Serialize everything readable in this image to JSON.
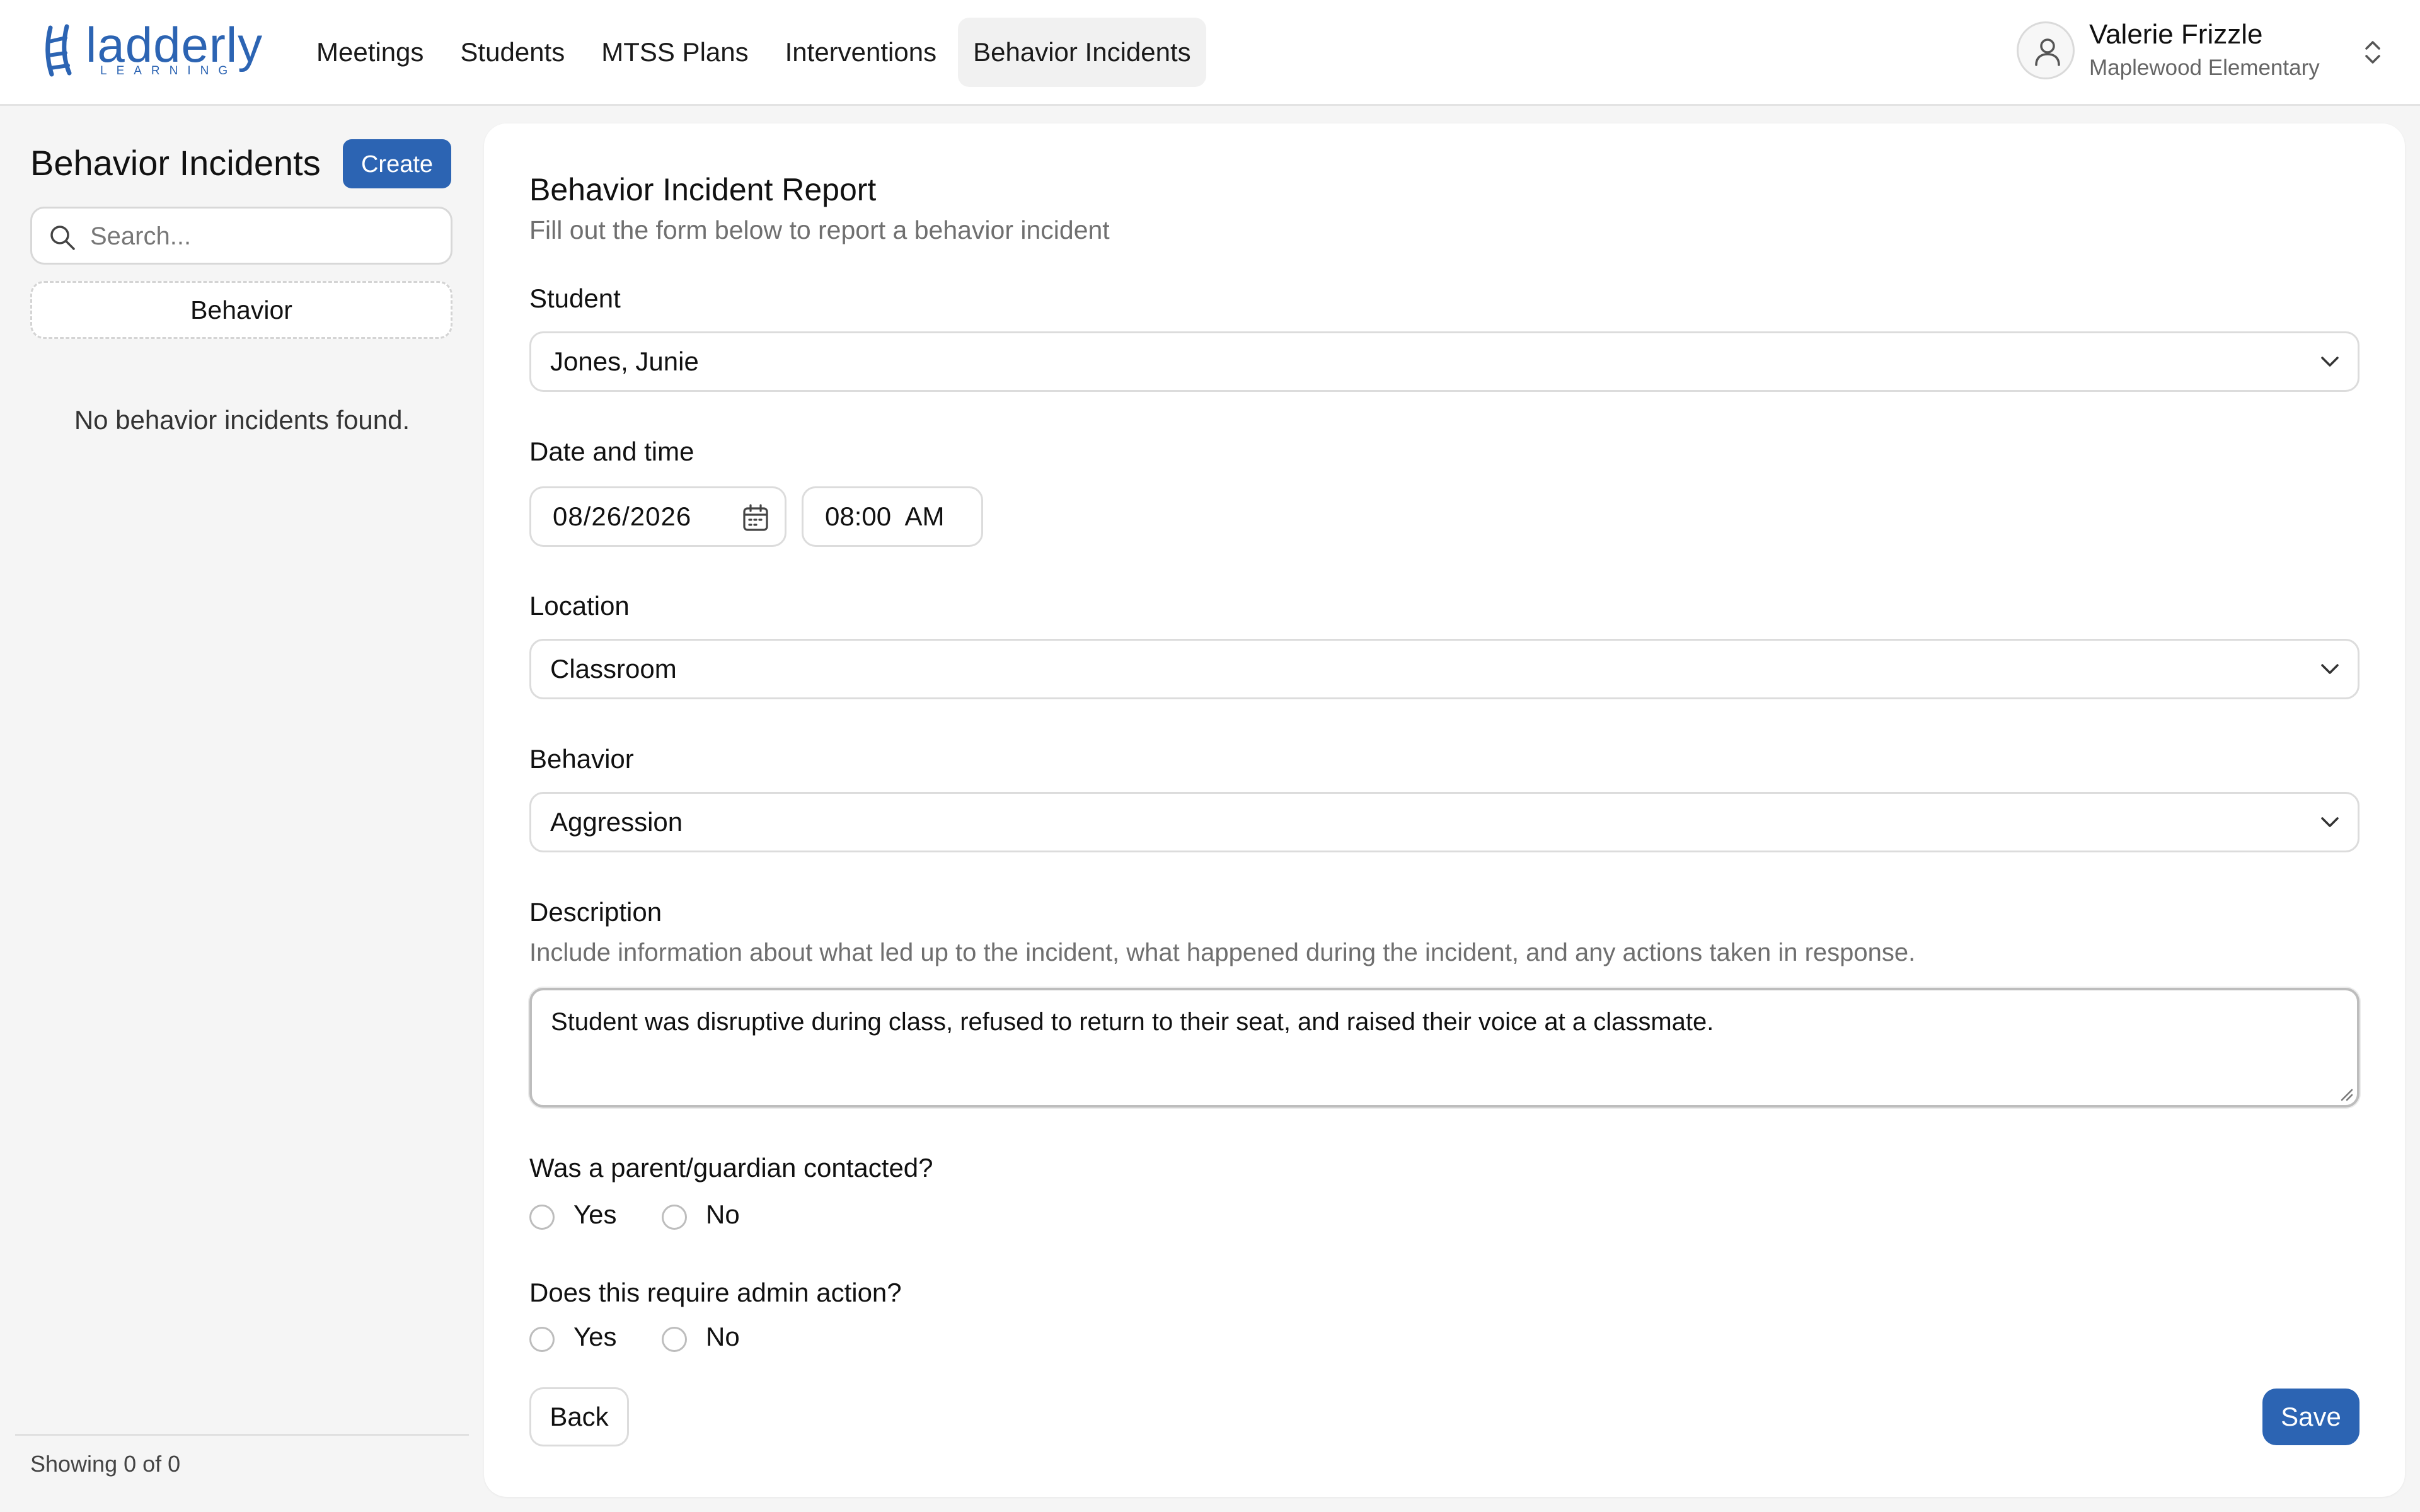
{
  "brand": {
    "name": "ladderly",
    "tagline": "LEARNING",
    "color": "#2c64b3"
  },
  "nav": {
    "items": [
      {
        "label": "Meetings"
      },
      {
        "label": "Students"
      },
      {
        "label": "MTSS Plans"
      },
      {
        "label": "Interventions"
      },
      {
        "label": "Behavior Incidents",
        "active": true
      }
    ]
  },
  "user": {
    "name": "Valerie Frizzle",
    "school": "Maplewood Elementary",
    "avatar_icon": "user-icon"
  },
  "sidebar": {
    "title": "Behavior Incidents",
    "create_label": "Create",
    "search_placeholder": "Search...",
    "filter_label": "Behavior",
    "empty_message": "No behavior incidents found.",
    "count_text": "Showing 0 of 0"
  },
  "form": {
    "title": "Behavior Incident Report",
    "subtitle": "Fill out the form below to report a behavior incident",
    "student": {
      "label": "Student",
      "value": "Jones, Junie"
    },
    "datetime": {
      "label": "Date and time",
      "date": "08/26/2026",
      "time": "08:00 AM"
    },
    "location": {
      "label": "Location",
      "value": "Classroom"
    },
    "behavior": {
      "label": "Behavior",
      "value": "Aggression"
    },
    "description": {
      "label": "Description",
      "helper": "Include information about what led up to the incident, what happened during the incident, and any actions taken in response.",
      "value": "Student was disruptive during class, refused to return to their seat, and raised their voice at a classmate."
    },
    "parent_contacted": {
      "label": "Was a parent/guardian contacted?",
      "options": [
        "Yes",
        "No"
      ],
      "selected": null
    },
    "admin_action": {
      "label": "Does this require admin action?",
      "options": [
        "Yes",
        "No"
      ],
      "selected": null
    },
    "back_label": "Back",
    "save_label": "Save"
  }
}
